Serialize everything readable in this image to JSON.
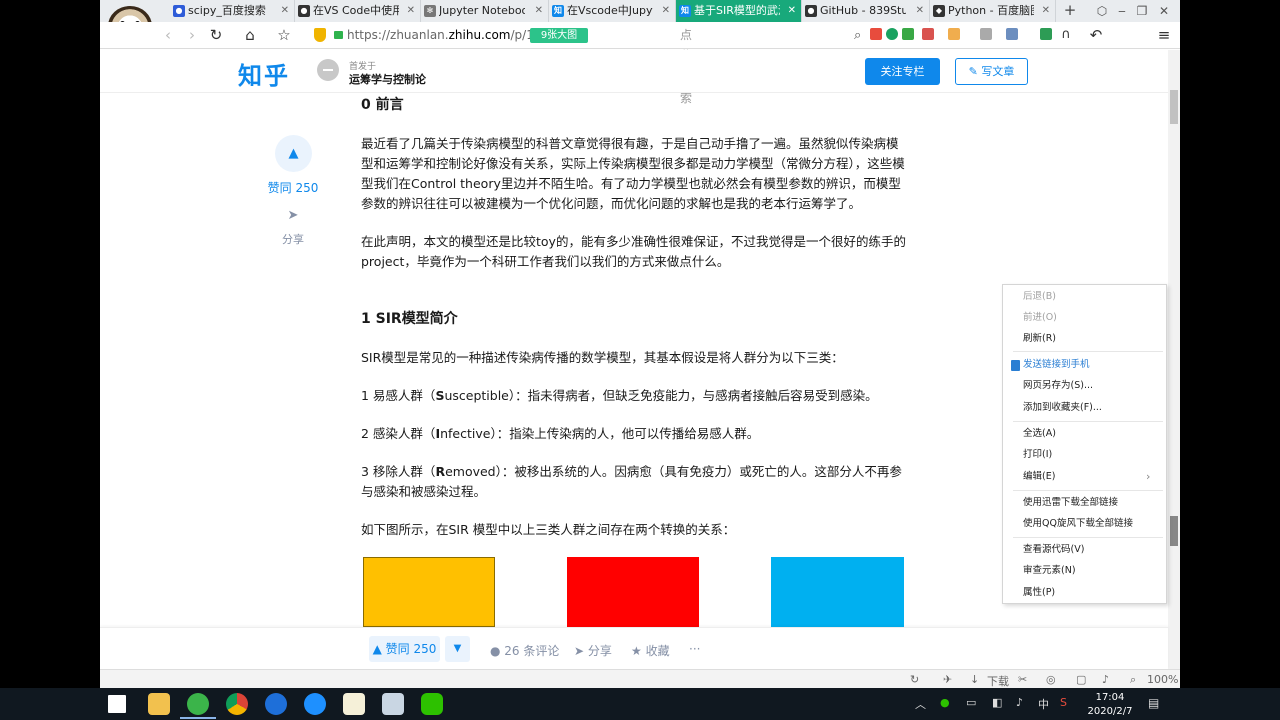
{
  "browser": {
    "tabs": [
      {
        "label": "scipy_百度搜索",
        "favicon": "paw-icon",
        "color": "#2e5cd8"
      },
      {
        "label": "在VS Code中使用",
        "favicon": "github-icon",
        "color": "#333333"
      },
      {
        "label": "Jupyter Notebook",
        "favicon": "gear-icon",
        "color": "#666666"
      },
      {
        "label": "在Vscode中Jupyter",
        "favicon": "zhihu-icon",
        "color": "#0f88eb"
      },
      {
        "label": "基于SIR模型的武汉",
        "favicon": "zhihu-icon",
        "color": "#0f88eb",
        "active": true
      },
      {
        "label": "GitHub - 839Stud",
        "favicon": "github-icon",
        "color": "#333333"
      },
      {
        "label": "Python - 百度脑图",
        "favicon": "python-icon",
        "color": "#333333"
      }
    ],
    "url_prefix": "https://zhuanlan.",
    "url_host": "zhihu.com",
    "url_path": "/p/10",
    "big_image_badge": "9张大图",
    "search_placeholder": "点此搜索",
    "zoom": "100%",
    "download_label": "下载"
  },
  "zhihu": {
    "logo": "知乎",
    "published_in_label": "首发于",
    "column_name": "运筹学与控制论",
    "follow_button": "关注专栏",
    "write_button": "写文章",
    "accent": "#0f88eb"
  },
  "sidebar": {
    "like_count": "赞同 250",
    "share_label": "分享"
  },
  "article": {
    "h0": "0 前言",
    "p1": "最近看了几篇关于传染病模型的科普文章觉得很有趣，于是自己动手撸了一遍。虽然貌似传染病模型和运筹学和控制论好像没有关系，实际上传染病模型很多都是动力学模型（常微分方程），这些模型我们在Control theory里边并不陌生哈。有了动力学模型也就必然会有模型参数的辨识，而模型参数的辨识往往可以被建模为一个优化问题，而优化问题的求解也是我的老本行运筹学了。",
    "p2": "在此声明，本文的模型还是比较toy的，能有多少准确性很难保证，不过我觉得是一个很好的练手的project，毕竟作为一个科研工作者我们以我们的方式来做点什么。",
    "h1": "1 SIR模型简介",
    "p3": "SIR模型是常见的一种描述传染病传播的数学模型，其基本假设是将人群分为以下三类：",
    "s_prefix": "1 易感人群（",
    "s_bold": "S",
    "s_suffix": "usceptible）：指未得病者，但缺乏免疫能力，与感病者接触后容易受到感染。",
    "i_prefix": "2 感染人群（",
    "i_bold": "I",
    "i_suffix": "nfective）：指染上传染病的人，他可以传播给易感人群。",
    "r_prefix": "3 移除人群（",
    "r_bold": "R",
    "r_suffix": "emoved）：被移出系统的人。因病愈（具有免疫力）或死亡的人。这部分人不再参与感染和被感染过程。",
    "p4": "如下图所示，在SIR 模型中以上三类人群之间存在两个转换的关系：",
    "box_colors": [
      "#ffc000",
      "#ff0000",
      "#00b0f0"
    ]
  },
  "actionbar": {
    "vote": "赞同 250",
    "comments": "26 条评论",
    "share": "分享",
    "favorite": "收藏",
    "more": "···"
  },
  "context_menu": {
    "items": [
      {
        "label": "后退(B)",
        "disabled": true
      },
      {
        "label": "前进(O)",
        "disabled": true
      },
      {
        "label": "刷新(R)"
      },
      {
        "label": "发送链接到手机",
        "highlight": true
      },
      {
        "label": "网页另存为(S)..."
      },
      {
        "label": "添加到收藏夹(F)..."
      },
      {
        "label": "全选(A)"
      },
      {
        "label": "打印(I)"
      },
      {
        "label": "编辑(E)",
        "submenu": true
      },
      {
        "label": "使用迅雷下载全部链接"
      },
      {
        "label": "使用QQ旋风下载全部链接"
      },
      {
        "label": "查看源代码(V)"
      },
      {
        "label": "审查元素(N)"
      },
      {
        "label": "属性(P)"
      }
    ]
  },
  "taskbar": {
    "time": "17:04",
    "date": "2020/2/7",
    "ime": "中"
  }
}
